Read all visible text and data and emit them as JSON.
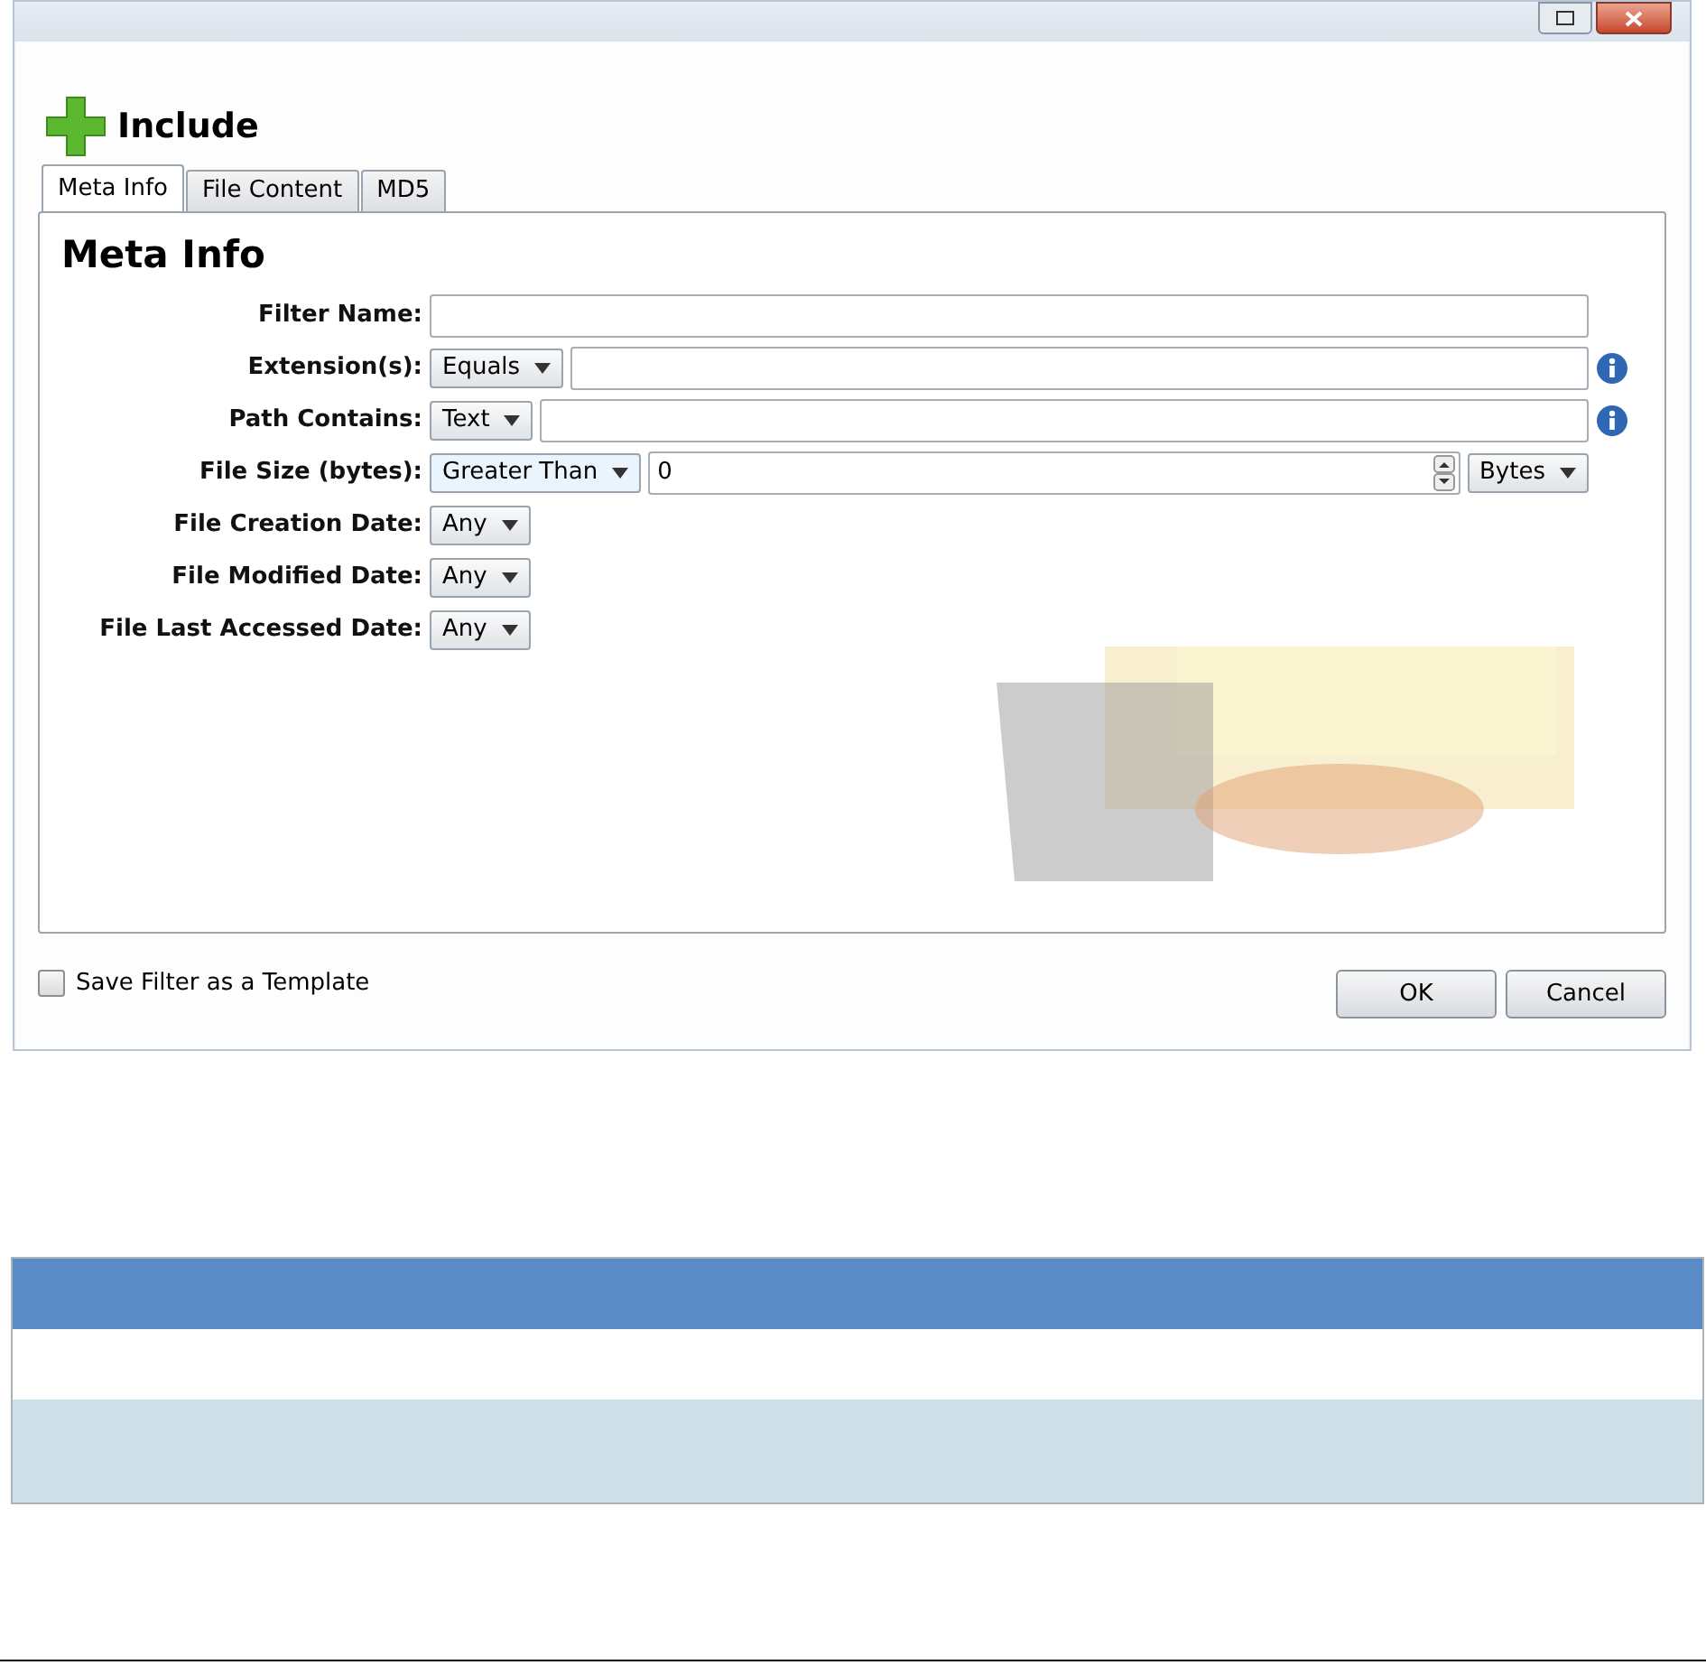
{
  "dialog": {
    "heading": "Include",
    "tabs": [
      {
        "label": "Meta Info",
        "selected": true
      },
      {
        "label": "File Content",
        "selected": false
      },
      {
        "label": "MD5",
        "selected": false
      }
    ],
    "section_title": "Meta Info",
    "fields": [
      {
        "kind": "text",
        "label": "Filter Name:"
      },
      {
        "kind": "select_text",
        "label": "Extension(s):",
        "option": "Equals",
        "info": true
      },
      {
        "kind": "select_text",
        "label": "Path Contains:",
        "option": "Text",
        "info": true
      },
      {
        "kind": "select_number",
        "label": "File Size (bytes):",
        "option": "Greater Than",
        "value": "0",
        "unit": "Bytes"
      },
      {
        "kind": "select",
        "label": "File Creation Date:",
        "option": "Any"
      },
      {
        "kind": "select",
        "label": "File Modified Date:",
        "option": "Any"
      },
      {
        "kind": "select",
        "label": "File Last Accessed Date:",
        "option": "Any"
      }
    ],
    "template_checkbox": {
      "label": "Save Filter as a Template",
      "checked": false
    },
    "buttons": [
      "OK",
      "Cancel"
    ]
  },
  "table": {
    "rows": [
      {
        "kind": "header"
      },
      {
        "kind": "plain"
      },
      {
        "kind": "shaded"
      }
    ]
  }
}
